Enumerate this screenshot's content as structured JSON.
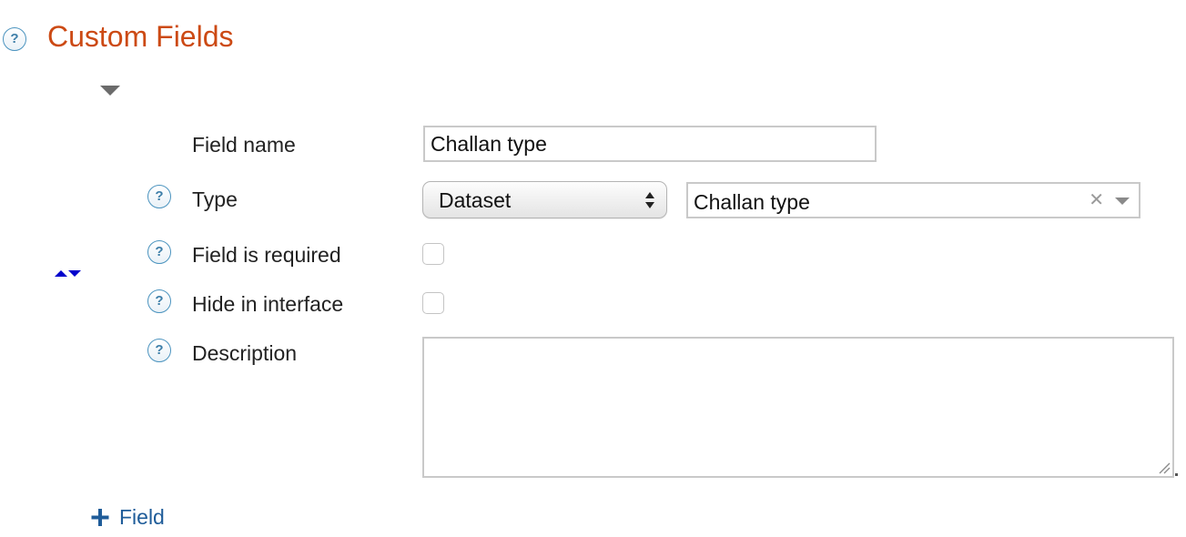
{
  "header": {
    "title": "Custom Fields",
    "help_icon": "help-question-icon"
  },
  "field": {
    "collapse_icon": "triangle-down-icon",
    "reorder_icon": "sort-up-down-icon",
    "name": {
      "label": "Field name",
      "value": "Challan type"
    },
    "type": {
      "label": "Type",
      "selected": "Dataset",
      "dataset_selected": "Challan type",
      "clear_symbol": "✕"
    },
    "required": {
      "label": "Field is required",
      "checked": false
    },
    "hide": {
      "label": "Hide in interface",
      "checked": false
    },
    "description": {
      "label": "Description",
      "value": ""
    }
  },
  "actions": {
    "add_field_label": "Field",
    "add_icon": "plus-icon"
  },
  "colors": {
    "title": "#cc4a14",
    "help_icon_border": "#4c94bf",
    "link": "#1f5c99",
    "reorder_arrows": "#0000cc"
  }
}
